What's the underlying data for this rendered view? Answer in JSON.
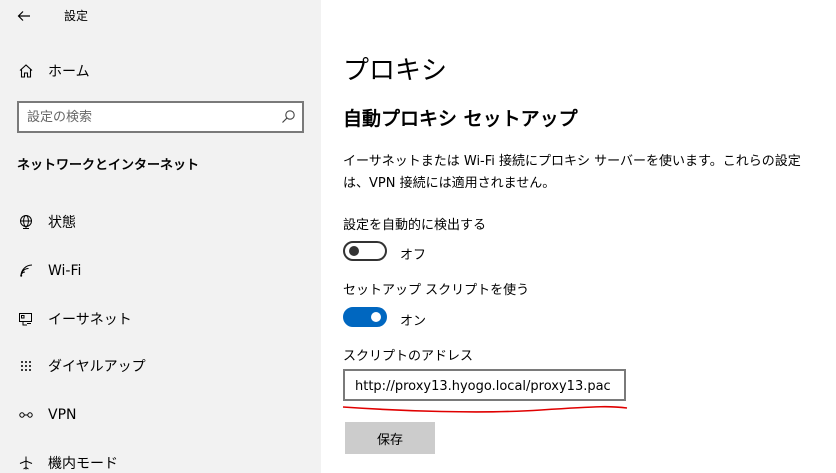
{
  "app": {
    "title": "設定"
  },
  "sidebar": {
    "home_label": "ホーム",
    "search": {
      "placeholder": "設定の検索"
    },
    "section_header": "ネットワークとインターネット",
    "items": [
      {
        "label": "状態",
        "icon": "globe-icon"
      },
      {
        "label": "Wi-Fi",
        "icon": "wifi-icon"
      },
      {
        "label": "イーサネット",
        "icon": "ethernet-icon"
      },
      {
        "label": "ダイヤルアップ",
        "icon": "dialup-icon"
      },
      {
        "label": "VPN",
        "icon": "vpn-icon"
      },
      {
        "label": "機内モード",
        "icon": "airplane-icon"
      }
    ]
  },
  "main": {
    "page_title": "プロキシ",
    "section_title": "自動プロキシ セットアップ",
    "description": "イーサネットまたは Wi-Fi 接続にプロキシ サーバーを使います。これらの設定は、VPN 接続には適用されません。",
    "auto_detect": {
      "label": "設定を自動的に検出する",
      "state": "オフ",
      "on": false
    },
    "use_script": {
      "label": "セットアップ スクリプトを使う",
      "state": "オン",
      "on": true
    },
    "script_address": {
      "label": "スクリプトのアドレス",
      "value": "http://proxy13.hyogo.local/proxy13.pac"
    },
    "save_label": "保存"
  },
  "colors": {
    "accent": "#0067c0",
    "sidebar_bg": "#f2f2f2",
    "annotation": "#e00000"
  }
}
